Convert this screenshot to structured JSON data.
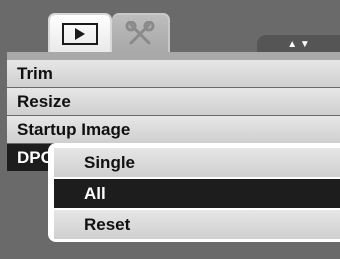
{
  "tabs": [
    {
      "name": "playback",
      "icon": "play-icon",
      "active": true
    },
    {
      "name": "setup",
      "icon": "wrench-icon",
      "active": false
    }
  ],
  "scroll_indicator": "▲ ▼",
  "menu": {
    "items": [
      {
        "label": "Trim"
      },
      {
        "label": "Resize"
      },
      {
        "label": "Startup Image"
      },
      {
        "label": "DPOF"
      }
    ]
  },
  "submenu": {
    "items": [
      {
        "label": "Single"
      },
      {
        "label": "All"
      },
      {
        "label": "Reset"
      }
    ],
    "selected": "All"
  },
  "colors": {
    "background": "#6a6a6a",
    "selected_row": "#1d1d1d",
    "row": "#dcdcdc"
  }
}
